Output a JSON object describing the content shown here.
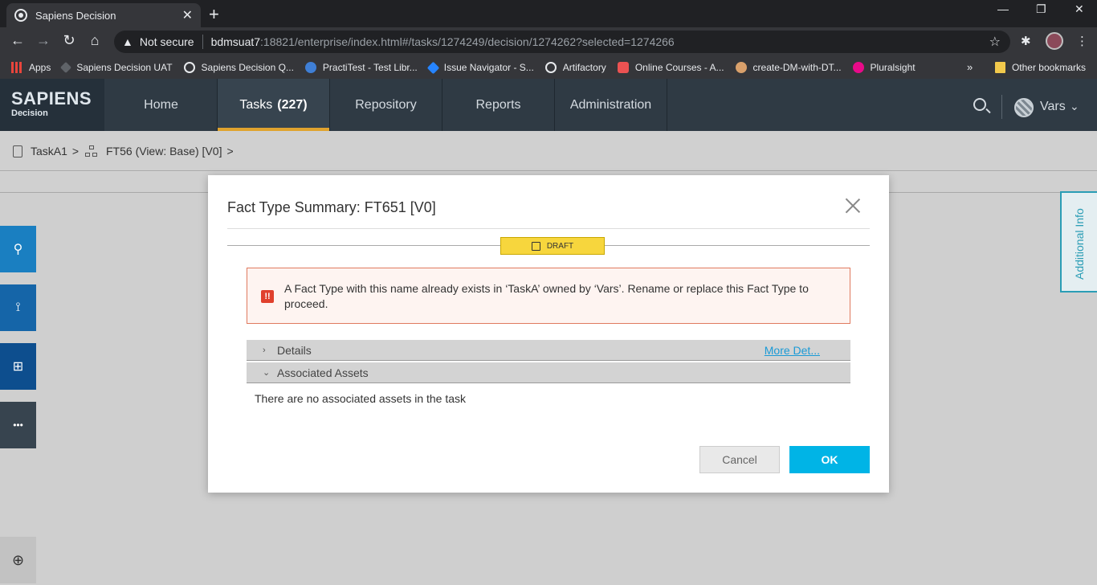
{
  "browser": {
    "tab_title": "Sapiens Decision",
    "tab_close": "✕",
    "new_tab": "+",
    "window_controls": [
      "—",
      "❐",
      "✕"
    ],
    "not_secure": "Not secure",
    "url_host": "bdmsuat7",
    "url_path": ":18821/enterprise/index.html#/tasks/1274249/decision/1274262?selected=1274266",
    "bookmarks": [
      {
        "label": "Apps",
        "icon": "apps-grid-icon",
        "color": "#e8453c"
      },
      {
        "label": "Sapiens Decision UAT",
        "icon": "diamond-icon",
        "color": "#5f6368"
      },
      {
        "label": "Sapiens Decision Q...",
        "icon": "globe-icon",
        "color": "#e8eaed"
      },
      {
        "label": "PractiTest - Test Libr...",
        "icon": "practitest-icon",
        "color": "#3f7fd6"
      },
      {
        "label": "Issue Navigator - S...",
        "icon": "jira-icon",
        "color": "#2684ff"
      },
      {
        "label": "Artifactory",
        "icon": "globe-icon",
        "color": "#e8eaed"
      },
      {
        "label": "Online Courses - A...",
        "icon": "udemy-icon",
        "color": "#ec5252"
      },
      {
        "label": "create-DM-with-DT...",
        "icon": "jenkins-icon",
        "color": "#d9a06b"
      },
      {
        "label": "Pluralsight",
        "icon": "pluralsight-icon",
        "color": "#e80a89"
      }
    ],
    "more_bookmarks": "»",
    "other_bookmarks": "Other bookmarks"
  },
  "app": {
    "logo_main": "SAPIENS",
    "logo_sub": "Decision",
    "nav": [
      {
        "label": "Home"
      },
      {
        "label": "Tasks",
        "count": "(227)"
      },
      {
        "label": "Repository"
      },
      {
        "label": "Reports"
      },
      {
        "label": "Administration"
      }
    ],
    "user": "Vars"
  },
  "breadcrumb": {
    "task": "TaskA1",
    "view": "FT56 (View: Base) [V0]",
    "sep": ">"
  },
  "sidebar": {
    "buttons": [
      {
        "icon": "stamp-icon",
        "glyph": "⚲",
        "color": "#1a7fc1"
      },
      {
        "icon": "test-tube-icon",
        "glyph": "⟟",
        "color": "#1565a8"
      },
      {
        "icon": "hierarchy-icon",
        "glyph": "⊞",
        "color": "#0d4e8e"
      },
      {
        "icon": "more-icon",
        "glyph": "•••",
        "color": "#37444f"
      }
    ],
    "zoom_glyph": "⊕"
  },
  "additional_info": "Additional Info",
  "modal": {
    "title": "Fact Type Summary: FT651 [V0]",
    "status": "DRAFT",
    "alert_icon": "!!",
    "alert": "A Fact Type with this name already exists in ‘TaskA’ owned by ‘Vars’. Rename or replace this Fact Type to proceed.",
    "sections": [
      {
        "label": "Details",
        "arrow": "›",
        "link": "More Det..."
      },
      {
        "label": "Associated Assets",
        "arrow": "⌄"
      }
    ],
    "no_assets": "There are no associated assets in the task",
    "cancel": "Cancel",
    "ok": "OK"
  }
}
